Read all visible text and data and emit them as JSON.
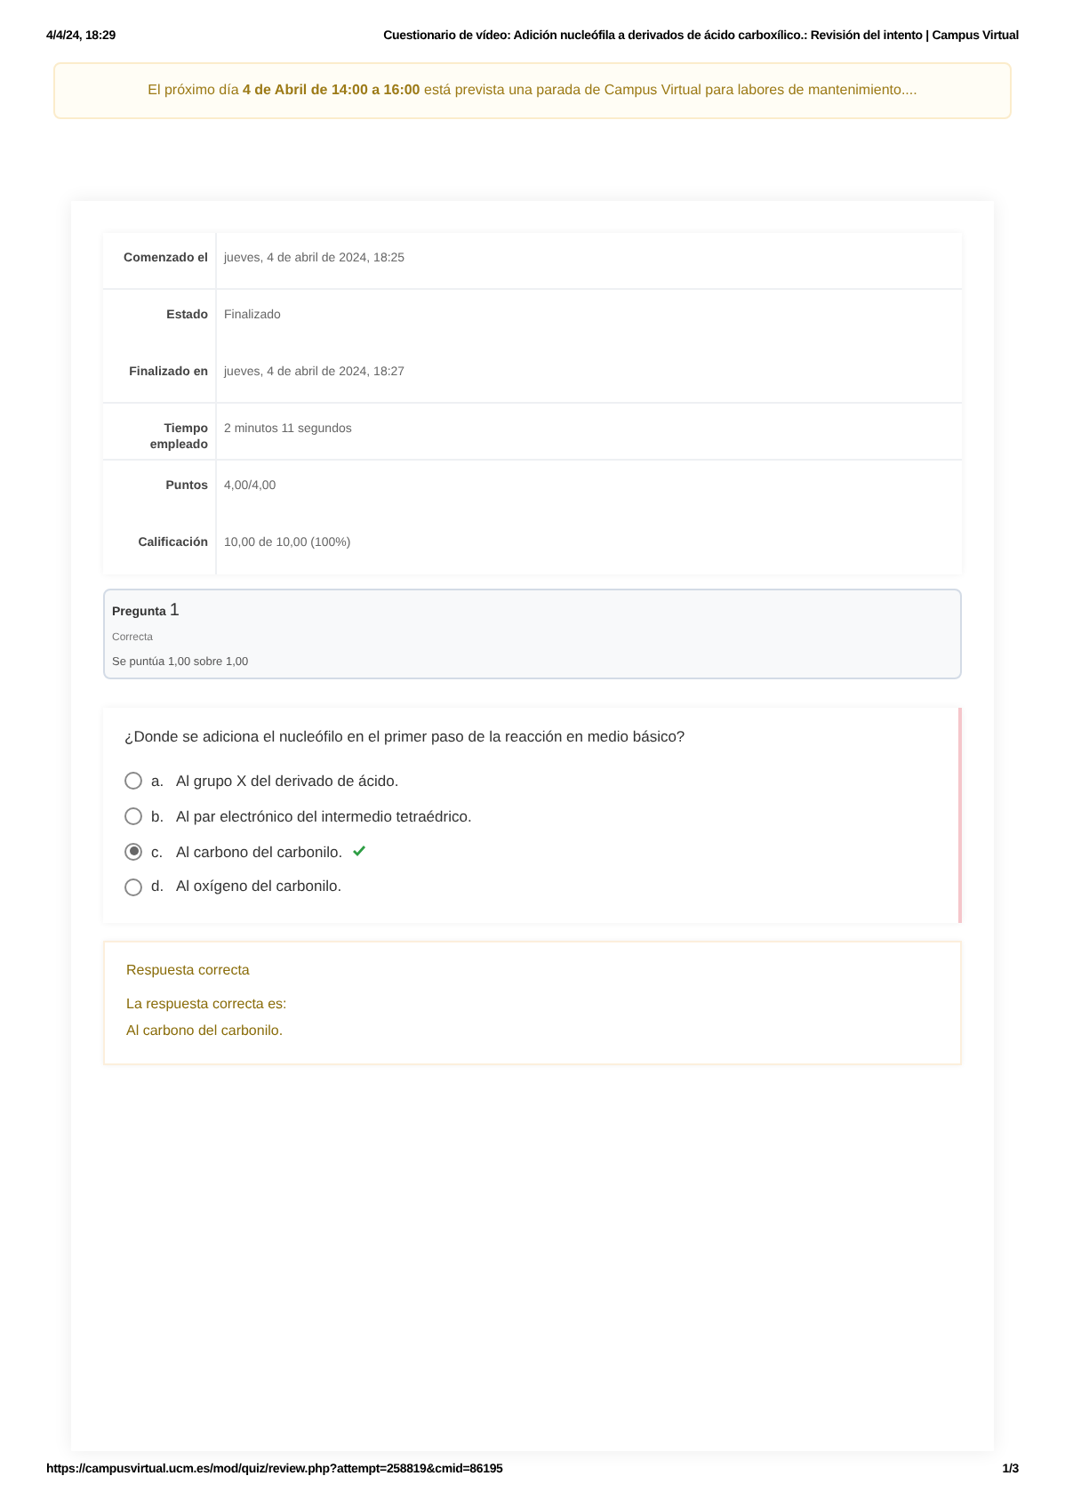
{
  "print_header": {
    "date": "4/4/24, 18:29",
    "title": "Cuestionario de vídeo: Adición nucleófila a derivados de ácido carboxílico.: Revisión del intento | Campus Virtual"
  },
  "notice": "El próximo día **4 de Abril de 14:00 a 16:00** está prevista una parada de Campus Virtual para labores de mantenimiento....",
  "summary": [
    {
      "label": "Comenzado el",
      "value": "jueves, 4 de abril de 2024, 18:25"
    },
    {
      "label": "Estado",
      "value": "Finalizado"
    },
    {
      "label": "Finalizado en",
      "value": "jueves, 4 de abril de 2024, 18:27"
    },
    {
      "label": "Tiempo empleado",
      "value": "2 minutos 11 segundos"
    },
    {
      "label": "Puntos",
      "value": "4,00/4,00"
    },
    {
      "label": "Calificación",
      "value": "10,00 de 10,00 (100%)"
    }
  ],
  "question_info": {
    "label": "Pregunta",
    "number": "1",
    "state": "Correcta",
    "grade": "Se puntúa 1,00 sobre 1,00"
  },
  "question": {
    "text": "¿Donde se adiciona el nucleófilo en el primer paso de la reacción en medio básico?",
    "options": [
      {
        "letter": "a.",
        "text": "Al grupo X del derivado de ácido.",
        "selected": false,
        "correct": false
      },
      {
        "letter": "b.",
        "text": "Al par electrónico del intermedio tetraédrico.",
        "selected": false,
        "correct": false
      },
      {
        "letter": "c.",
        "text": "Al carbono del carbonilo.",
        "selected": true,
        "correct": true
      },
      {
        "letter": "d.",
        "text": "Al oxígeno del carbonilo.",
        "selected": false,
        "correct": false
      }
    ]
  },
  "feedback": {
    "title": "Respuesta correcta",
    "intro": "La respuesta correcta es:",
    "answer": "Al carbono del carbonilo."
  },
  "print_footer": {
    "url": "https://campusvirtual.ucm.es/mod/quiz/review.php?attempt=258819&cmid=86195",
    "page": "1/3"
  }
}
